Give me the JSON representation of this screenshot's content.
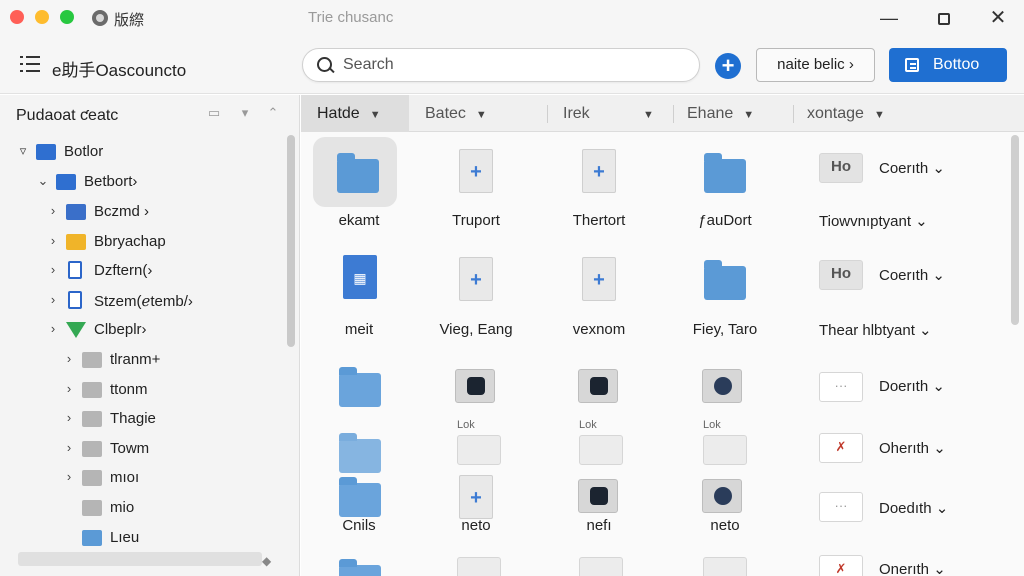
{
  "window": {
    "app_name": "版縩",
    "title": "Trie chusanc",
    "min": "—",
    "close": "✕"
  },
  "toolbar": {
    "breadcrumb": "e助手Oascouncto",
    "search_placeholder": "Search",
    "add_symbol": "+",
    "outline_button": "naite belic ›",
    "primary_button": "Bottoo"
  },
  "sidebar": {
    "header": "Pudaoat ƈeatc",
    "items": [
      {
        "label": "Botlor",
        "chev": "▿",
        "expanded_chev": "⌄",
        "icon": "folder",
        "color": "#2f6fd0"
      },
      {
        "label": "Betbort›",
        "chev": "⌄",
        "icon": "folder",
        "color": "#2f6fd0"
      },
      {
        "label": "Bczmd ›",
        "chev": "›",
        "icon": "folder-image",
        "color": "#3a6fc9"
      },
      {
        "label": "Bbryachap",
        "chev": "›",
        "icon": "folder",
        "color": "#f0b429"
      },
      {
        "label": "Dzftern(›",
        "chev": "›",
        "icon": "doc",
        "color": "#2b65c9"
      },
      {
        "label": "Stzem(ℯtemb/›",
        "chev": "›",
        "icon": "doc",
        "color": "#2b65c9"
      },
      {
        "label": "Clbeplr›",
        "chev": "›",
        "icon": "drive",
        "color": "#34a853"
      },
      {
        "label": "tlranm+",
        "chev": "›",
        "icon": "folder",
        "color": "#b5b5b5"
      },
      {
        "label": "ttonm",
        "chev": "›",
        "icon": "folder",
        "color": "#b5b5b5"
      },
      {
        "label": "Thagie",
        "chev": "›",
        "icon": "folder",
        "color": "#b5b5b5"
      },
      {
        "label": "Towm",
        "chev": "›",
        "icon": "folder",
        "color": "#b5b5b5"
      },
      {
        "label": "mıoı",
        "chev": "›",
        "icon": "folder",
        "color": "#b5b5b5"
      },
      {
        "label": "mio",
        "chev": "",
        "icon": "folder",
        "color": "#b5b5b5"
      },
      {
        "label": "Lıeu",
        "chev": "",
        "icon": "folder",
        "color": "#5b9ad6"
      }
    ],
    "controls": [
      "▭",
      "▾",
      "⌃"
    ]
  },
  "columns": [
    {
      "label": "Hatde",
      "active": true
    },
    {
      "label": "Batec",
      "active": false
    },
    {
      "label": "Irek",
      "active": false
    },
    {
      "label": "Ehane",
      "active": false
    },
    {
      "label": "xontage",
      "active": false
    }
  ],
  "grid": {
    "row1": [
      "ekamt",
      "Truport",
      "Thertort",
      "ƒauDort",
      "Tiowvnıptyant ⌄"
    ],
    "row2": [
      "meit",
      "Vieg, Eang",
      "vexnom",
      "Fiey, Taro",
      "Thear hlbtyant ⌄"
    ],
    "row4_sub": [
      "Lok",
      "Lok",
      "Lok"
    ],
    "row5": [
      "Cnils",
      "neto",
      "nefı",
      "neto"
    ],
    "right_col": [
      {
        "icon_text": "Ho",
        "label": "Coerıth ⌄"
      },
      {
        "icon_text": "Ho",
        "label": "Coerıth ⌄"
      },
      {
        "icon_text": "···",
        "label": "Doerıth ⌄"
      },
      {
        "icon_text": "✗",
        "label": "Oherıth ⌄"
      },
      {
        "icon_text": "···",
        "label": "Doedıth ⌄"
      },
      {
        "icon_text": "✗",
        "label": "Onerıth ⌄"
      }
    ],
    "plus": "+"
  }
}
